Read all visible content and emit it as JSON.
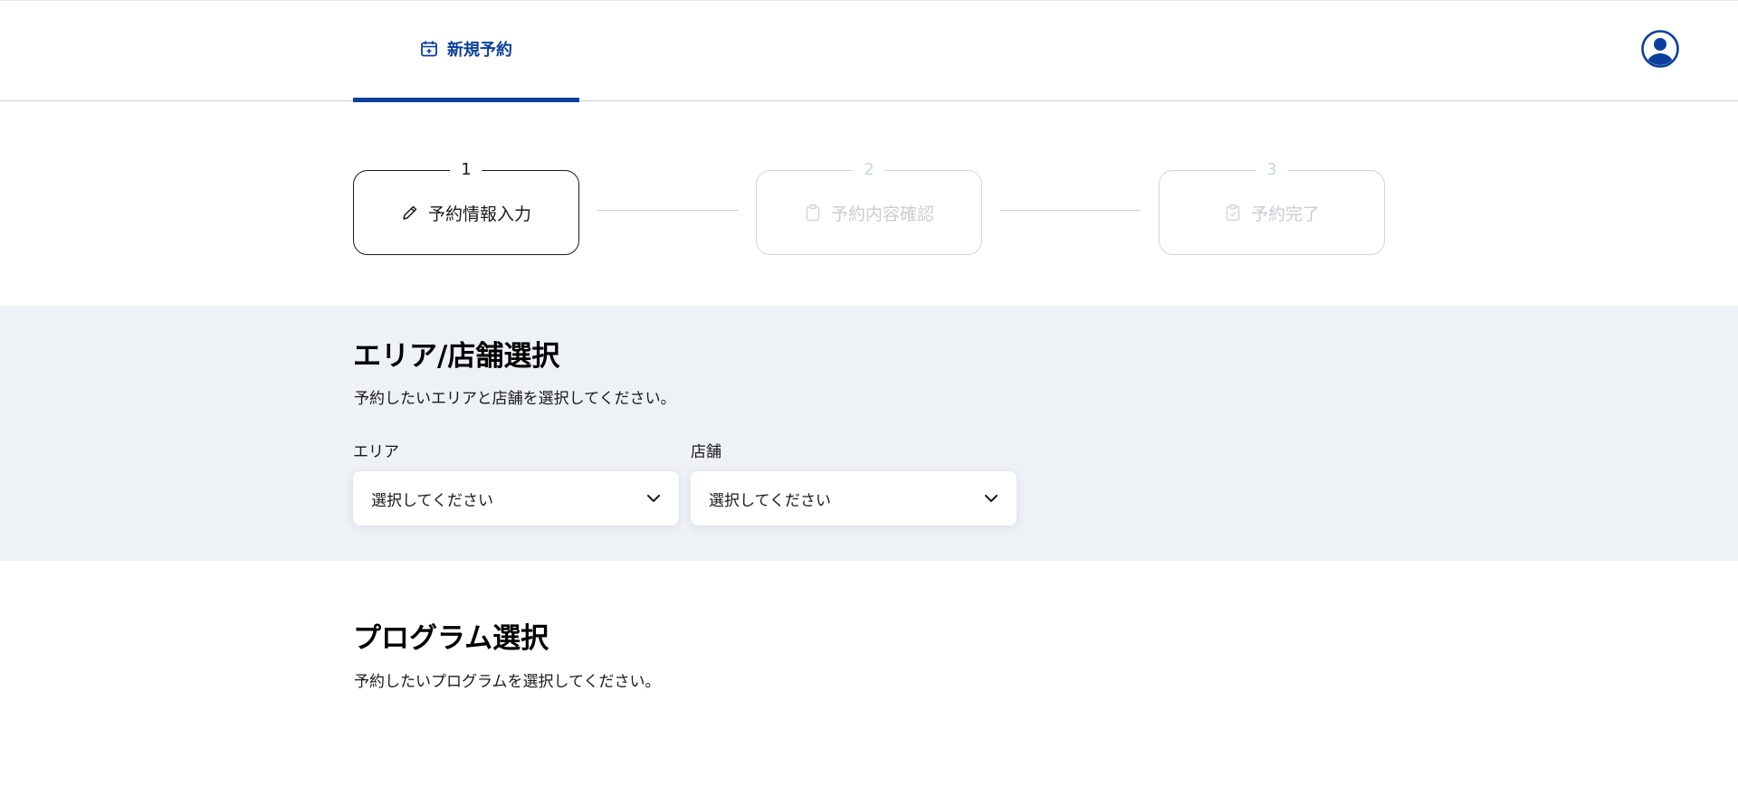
{
  "header": {
    "nav_tab_label": "新規予約",
    "icons": {
      "nav": "calendar-plus-icon",
      "avatar": "user-circle-icon"
    }
  },
  "stepper": {
    "steps": [
      {
        "number": "1",
        "label": "予約情報入力",
        "icon": "pencil-icon",
        "state": "active"
      },
      {
        "number": "2",
        "label": "予約内容確認",
        "icon": "clipboard-icon",
        "state": "inactive"
      },
      {
        "number": "3",
        "label": "予約完了",
        "icon": "clipboard-check-icon",
        "state": "inactive"
      }
    ]
  },
  "area_section": {
    "title": "エリア/店舗選択",
    "description": "予約したいエリアと店舗を選択してください。",
    "area_field": {
      "label": "エリア",
      "value": "選択してください"
    },
    "store_field": {
      "label": "店舗",
      "value": "選択してください"
    }
  },
  "program_section": {
    "title": "プログラム選択",
    "description": "予約したいプログラムを選択してください。"
  },
  "colors": {
    "brand": "#0b3f9e",
    "section_bg": "#eef1f6",
    "inactive_step": "#c9ccd2"
  }
}
